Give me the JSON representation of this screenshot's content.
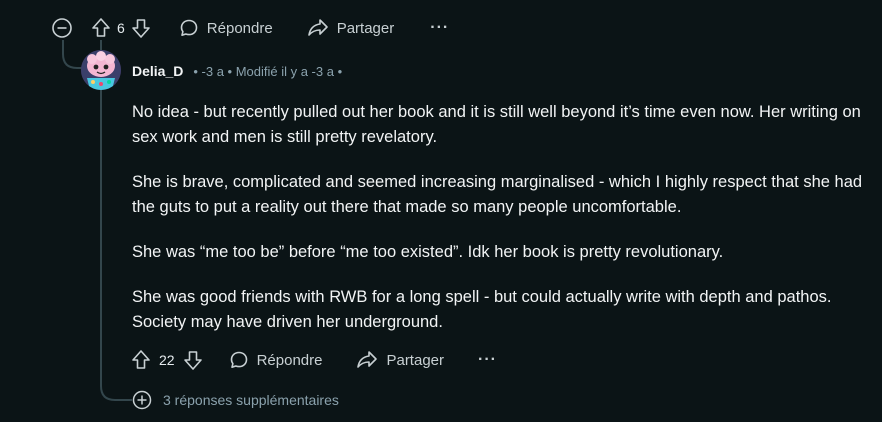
{
  "parent_actions": {
    "vote_count": "6",
    "reply_label": "Répondre",
    "share_label": "Partager",
    "more_label": "···"
  },
  "comment": {
    "author": "Delia_D",
    "meta": "• -3 a • Modifié il y a -3 a •",
    "paragraphs": [
      "No idea - but recently pulled out her book and it is still well beyond it’s time even now. Her writing on sex work and men is still pretty revelatory.",
      "She is brave, complicated and seemed increasing marginalised - which I highly respect that she had the guts to put a reality out there that made so many people uncomfortable.",
      "She was “me too be” before “me too existed”. Idk her book is pretty revolutionary.",
      "She was good friends with RWB for a long spell - but could actually write with depth and pathos. Society may have driven her underground."
    ],
    "vote_count": "22",
    "reply_label": "Répondre",
    "share_label": "Partager",
    "more_label": "···"
  },
  "more_replies_label": "3 réponses supplémentaires",
  "colors": {
    "background": "#0b1416",
    "text": "#f2f4f5",
    "muted": "#8ba2ad",
    "thread_line": "#33464c"
  }
}
